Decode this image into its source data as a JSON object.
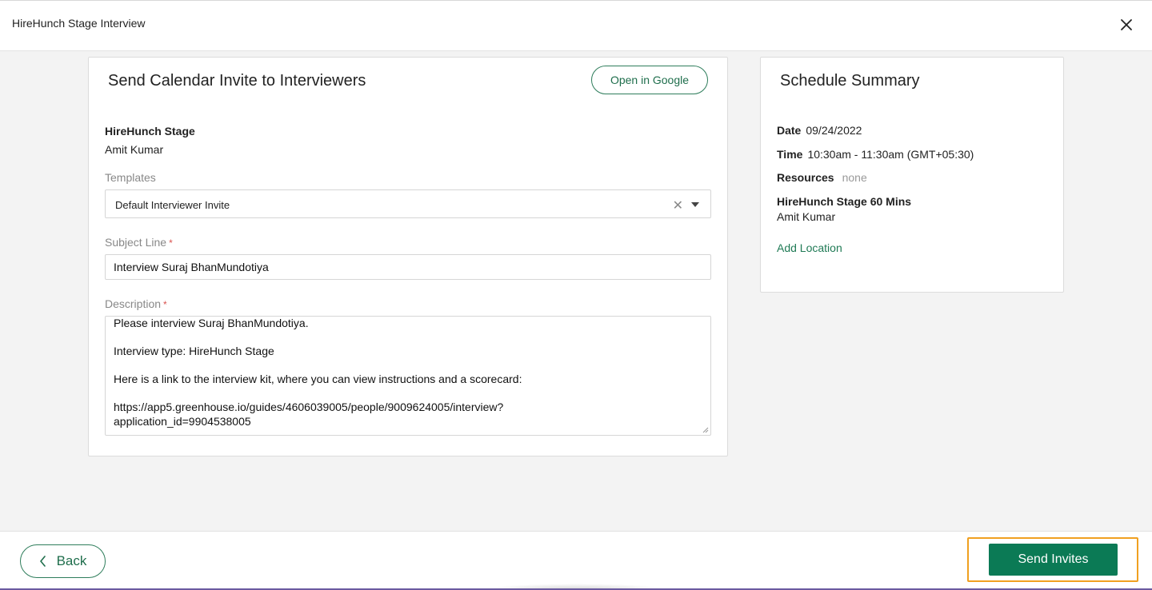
{
  "window": {
    "title": "HireHunch Stage Interview"
  },
  "invite_card": {
    "title": "Send Calendar Invite to Interviewers",
    "open_google_label": "Open in Google",
    "stage_name": "HireHunch Stage",
    "interviewer": "Amit Kumar",
    "templates": {
      "label": "Templates",
      "selected": "Default Interviewer Invite"
    },
    "subject": {
      "label": "Subject Line",
      "required_mark": "*",
      "value": "Interview Suraj BhanMundotiya"
    },
    "description": {
      "label": "Description",
      "required_mark": "*",
      "lines": [
        "Please interview Suraj BhanMundotiya.",
        "",
        "Interview type: HireHunch Stage",
        "",
        "Here is a link to the interview kit, where you can view instructions and a scorecard:",
        "",
        "https://app5.greenhouse.io/guides/4606039005/people/9009624005/interview?",
        "application_id=9904538005"
      ]
    }
  },
  "summary_card": {
    "title": "Schedule Summary",
    "date_label": "Date",
    "date_value": "09/24/2022",
    "time_label": "Time",
    "time_value": "10:30am - 11:30am (GMT+05:30)",
    "resources_label": "Resources",
    "resources_value": "none",
    "interview_name": "HireHunch Stage 60 Mins",
    "interviewer": "Amit Kumar",
    "add_location_label": "Add Location"
  },
  "footer": {
    "back_label": "Back",
    "send_label": "Send Invites"
  },
  "icons": {
    "close": "close-icon",
    "clear": "clear-icon",
    "dropdown": "chevron-down-icon",
    "back": "chevron-left-icon"
  },
  "colors": {
    "accent": "#0b7a55",
    "link": "#1f7a55",
    "highlight": "#f0a020",
    "required": "#d9534f"
  }
}
